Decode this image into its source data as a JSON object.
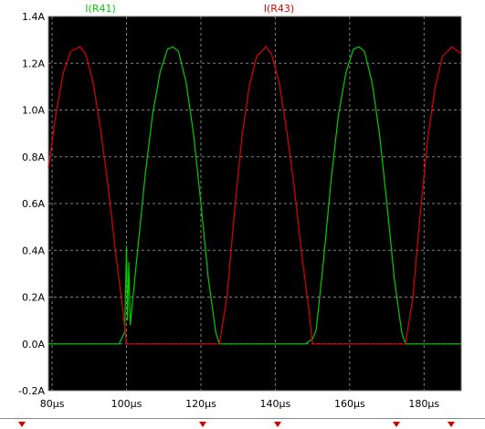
{
  "chart_data": {
    "type": "line",
    "title": "",
    "xlabel": "",
    "ylabel": "",
    "x_unit": "µs",
    "y_unit": "A",
    "xlim": [
      79,
      190
    ],
    "ylim": [
      -0.2,
      1.4
    ],
    "x_ticks": [
      80,
      100,
      120,
      140,
      160,
      180
    ],
    "x_tick_labels": [
      "80µs",
      "100µs",
      "120µs",
      "140µs",
      "160µs",
      "180µs"
    ],
    "y_ticks": [
      -0.2,
      0.0,
      0.2,
      0.4,
      0.6,
      0.8,
      1.0,
      1.2,
      1.4
    ],
    "y_tick_labels": [
      "-0.2A",
      "0.0A",
      "0.2A",
      "0.4A",
      "0.6A",
      "0.8A",
      "1.0A",
      "1.2A",
      "1.4A"
    ],
    "grid": true,
    "legend_position": "top",
    "series": [
      {
        "name": "I(R41)",
        "color": "#00cc00",
        "x": [
          79,
          95,
          98,
          99.5,
          100,
          100.3,
          100.6,
          101,
          103,
          105,
          107,
          109,
          111,
          112.5,
          114,
          116,
          118,
          120,
          122,
          124,
          125,
          145,
          148,
          150,
          151,
          153,
          155,
          157,
          159,
          161,
          162.5,
          164,
          166,
          168,
          170,
          172,
          174,
          175,
          190
        ],
        "y": [
          0.0,
          0.0,
          0.0,
          0.05,
          0.42,
          0.1,
          0.35,
          0.08,
          0.4,
          0.72,
          0.98,
          1.16,
          1.26,
          1.27,
          1.25,
          1.12,
          0.9,
          0.6,
          0.28,
          0.05,
          0.0,
          0.0,
          0.0,
          0.02,
          0.06,
          0.36,
          0.7,
          0.98,
          1.16,
          1.26,
          1.27,
          1.25,
          1.12,
          0.9,
          0.6,
          0.28,
          0.05,
          0.0,
          0.0
        ]
      },
      {
        "name": "I(R43)",
        "color": "#e00000",
        "x": [
          79,
          81,
          83,
          85,
          87.5,
          89,
          91,
          93,
          95,
          97,
          99,
          100,
          101,
          125,
          127,
          129,
          131,
          133,
          135,
          137.5,
          139,
          141,
          143,
          145,
          147,
          149,
          150,
          151,
          175,
          177,
          179,
          181,
          183,
          185,
          187.5,
          190
        ],
        "y": [
          0.75,
          0.98,
          1.16,
          1.25,
          1.27,
          1.24,
          1.12,
          0.92,
          0.68,
          0.4,
          0.15,
          0.0,
          0.0,
          0.0,
          0.2,
          0.56,
          0.88,
          1.1,
          1.23,
          1.27,
          1.24,
          1.12,
          0.92,
          0.68,
          0.4,
          0.15,
          0.0,
          0.0,
          0.0,
          0.2,
          0.56,
          0.88,
          1.1,
          1.23,
          1.27,
          1.24
        ]
      }
    ]
  }
}
